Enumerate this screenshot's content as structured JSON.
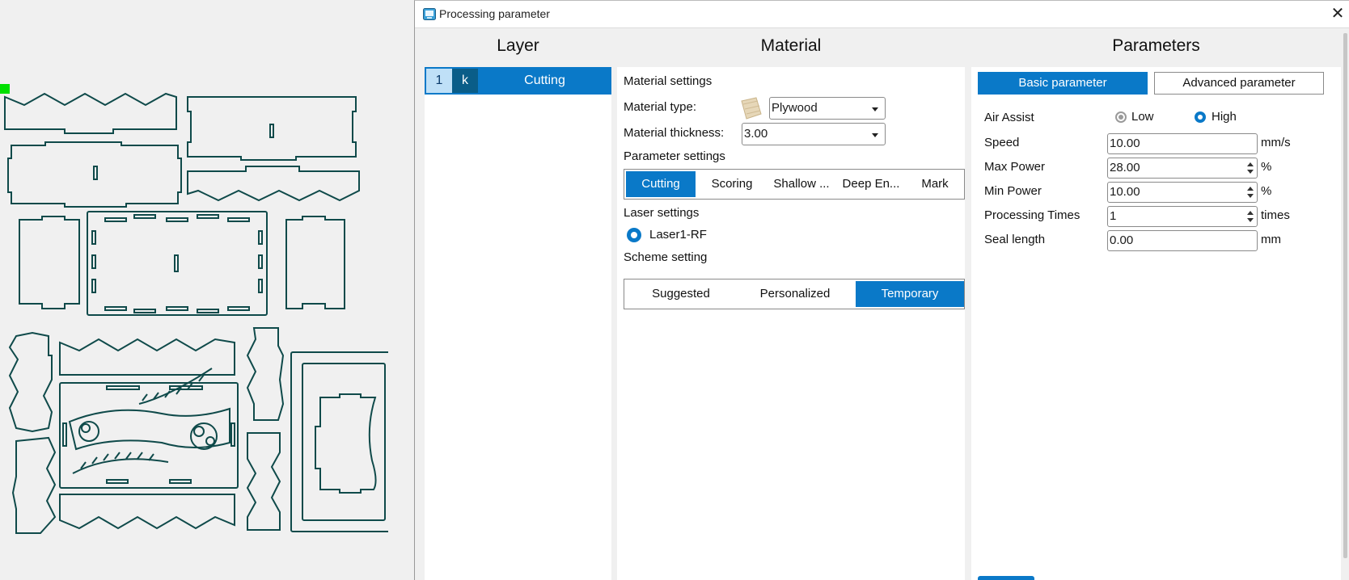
{
  "window": {
    "title": "Processing parameter",
    "close_glyph": "✕"
  },
  "columns": {
    "layer": "Layer",
    "material": "Material",
    "parameters": "Parameters"
  },
  "layer": {
    "number": "1",
    "mode": "k",
    "name": "Cutting"
  },
  "material": {
    "material_settings": "Material settings",
    "material_type_label": "Material type:",
    "material_type_value": "Plywood",
    "thickness_label": "Material thickness:",
    "thickness_value": "3.00",
    "parameter_settings": "Parameter settings",
    "param_tabs": [
      {
        "label": "Cutting",
        "active": true
      },
      {
        "label": "Scoring",
        "active": false
      },
      {
        "label": "Shallow ...",
        "active": false
      },
      {
        "label": "Deep En...",
        "active": false
      },
      {
        "label": "Mark",
        "active": false
      }
    ],
    "laser_settings": "Laser settings",
    "laser_option": "Laser1-RF",
    "scheme_setting": "Scheme setting",
    "scheme_tabs": [
      {
        "label": "Suggested",
        "active": false
      },
      {
        "label": "Personalized",
        "active": false
      },
      {
        "label": "Temporary",
        "active": true
      }
    ]
  },
  "parameters": {
    "tab_basic": "Basic parameter",
    "tab_advanced": "Advanced parameter",
    "air_assist_label": "Air Assist",
    "air_low": "Low",
    "air_high": "High",
    "air_selected": "High",
    "speed_label": "Speed",
    "speed_value": "10.00",
    "speed_unit": "mm/s",
    "max_power_label": "Max Power",
    "max_power_value": "28.00",
    "max_power_unit": "%",
    "min_power_label": "Min Power",
    "min_power_value": "10.00",
    "min_power_unit": "%",
    "times_label": "Processing Times",
    "times_value": "1",
    "times_unit": "times",
    "seal_label": "Seal length",
    "seal_value": "0.00",
    "seal_unit": "mm"
  },
  "colors": {
    "accent": "#0a79c8",
    "design_stroke": "#0f4a4a",
    "origin_marker": "#00e000"
  },
  "icons": {
    "app": "app-icon",
    "close": "close-icon",
    "material": "plywood-swatch-icon"
  }
}
